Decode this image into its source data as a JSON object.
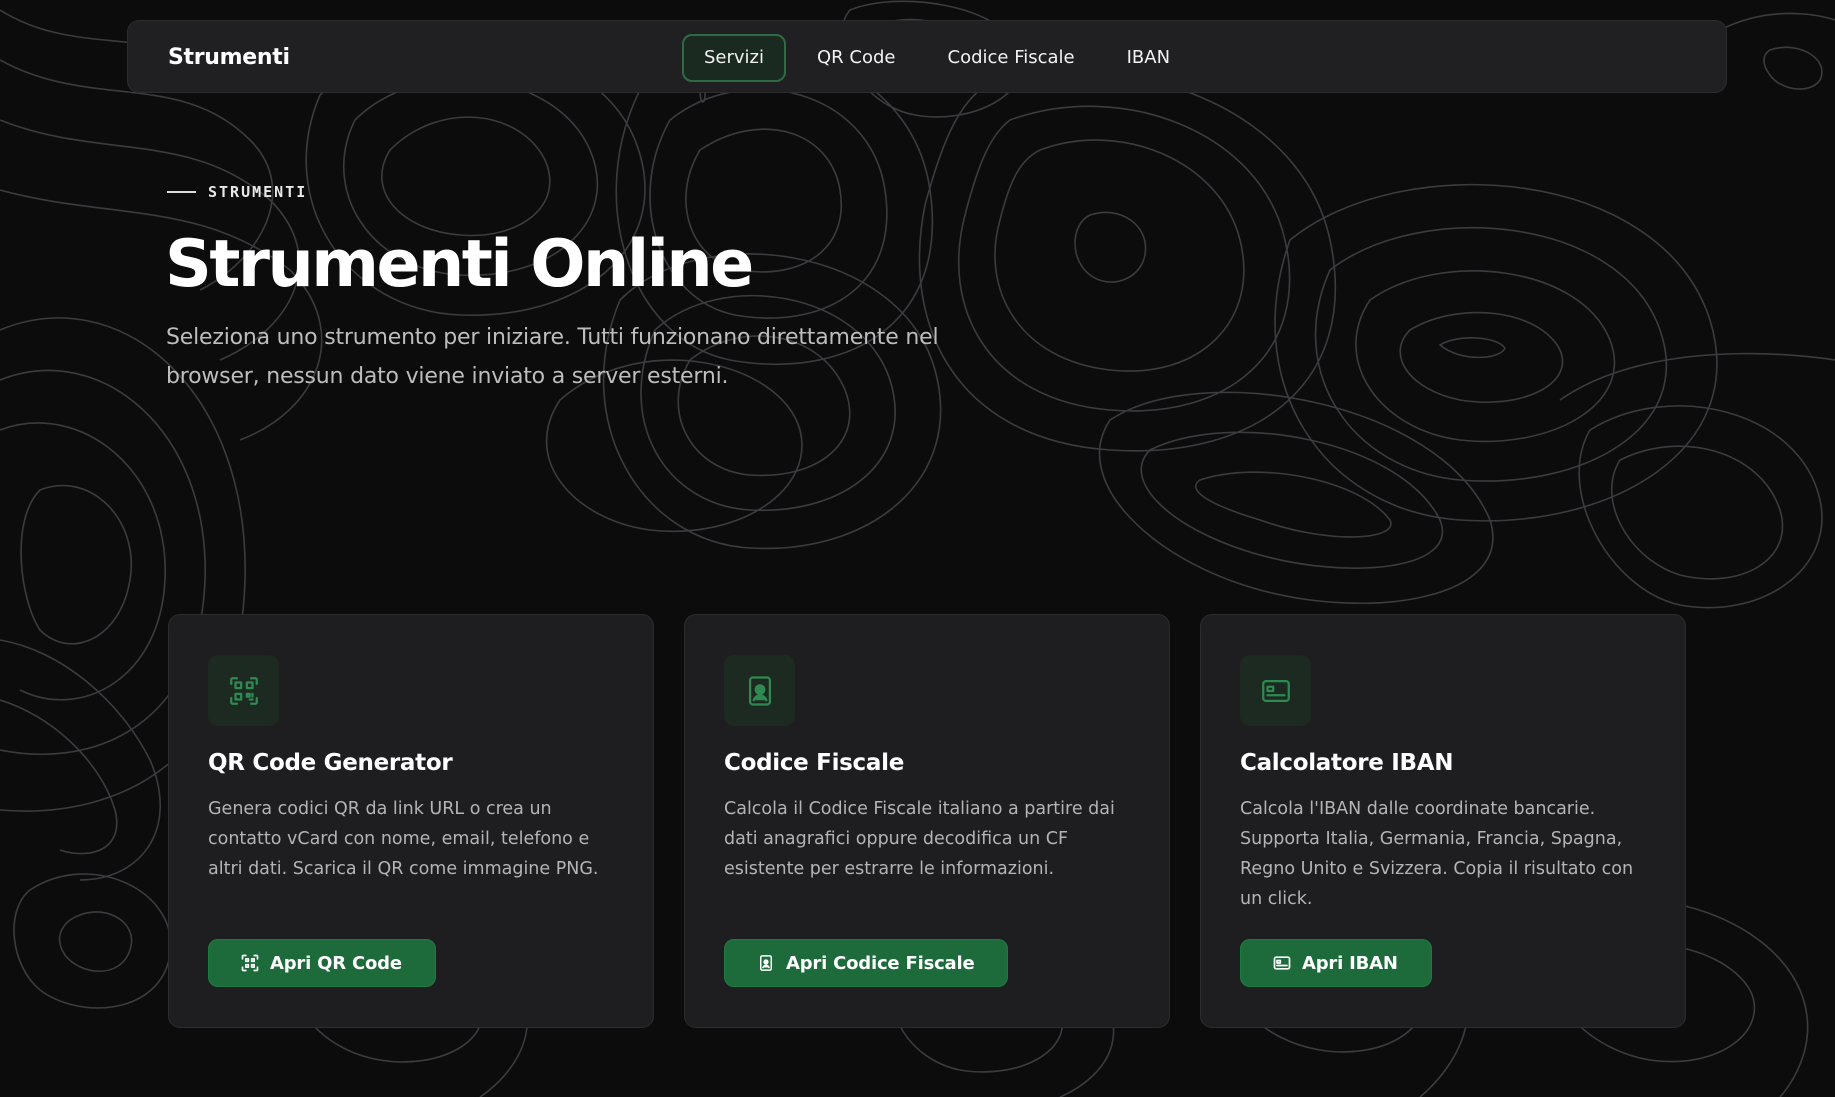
{
  "navbar": {
    "brand": "Strumenti",
    "links": [
      {
        "label": "Servizi",
        "active": true
      },
      {
        "label": "QR Code",
        "active": false
      },
      {
        "label": "Codice Fiscale",
        "active": false
      },
      {
        "label": "IBAN",
        "active": false
      }
    ]
  },
  "hero": {
    "kicker": "STRUMENTI",
    "title": "Strumenti Online",
    "subtitle": "Seleziona uno strumento per iniziare. Tutti funzionano direttamente nel browser, nessun dato viene inviato a server esterni."
  },
  "cards": [
    {
      "icon": "qr-code-icon",
      "title": "QR Code Generator",
      "description": "Genera codici QR da link URL o crea un contatto vCard con nome, email, telefono e altri dati. Scarica il QR come immagine PNG.",
      "button_label": "Apri QR Code"
    },
    {
      "icon": "id-badge-icon",
      "title": "Codice Fiscale",
      "description": "Calcola il Codice Fiscale italiano a partire dai dati anagrafici oppure decodifica un CF esistente per estrarre le informazioni.",
      "button_label": "Apri Codice Fiscale"
    },
    {
      "icon": "bank-card-icon",
      "title": "Calcolatore IBAN",
      "description": "Calcola l'IBAN dalle coordinate bancarie. Supporta Italia, Germania, Francia, Spagna, Regno Unito e Svizzera. Copia il risultato con un click.",
      "button_label": "Apri IBAN"
    }
  ],
  "colors": {
    "background": "#0c0c0d",
    "surface": "#1e1e20",
    "accent": "#1d6b3a",
    "accent_border": "#2e6b45",
    "icon_green": "#2f8a52"
  }
}
